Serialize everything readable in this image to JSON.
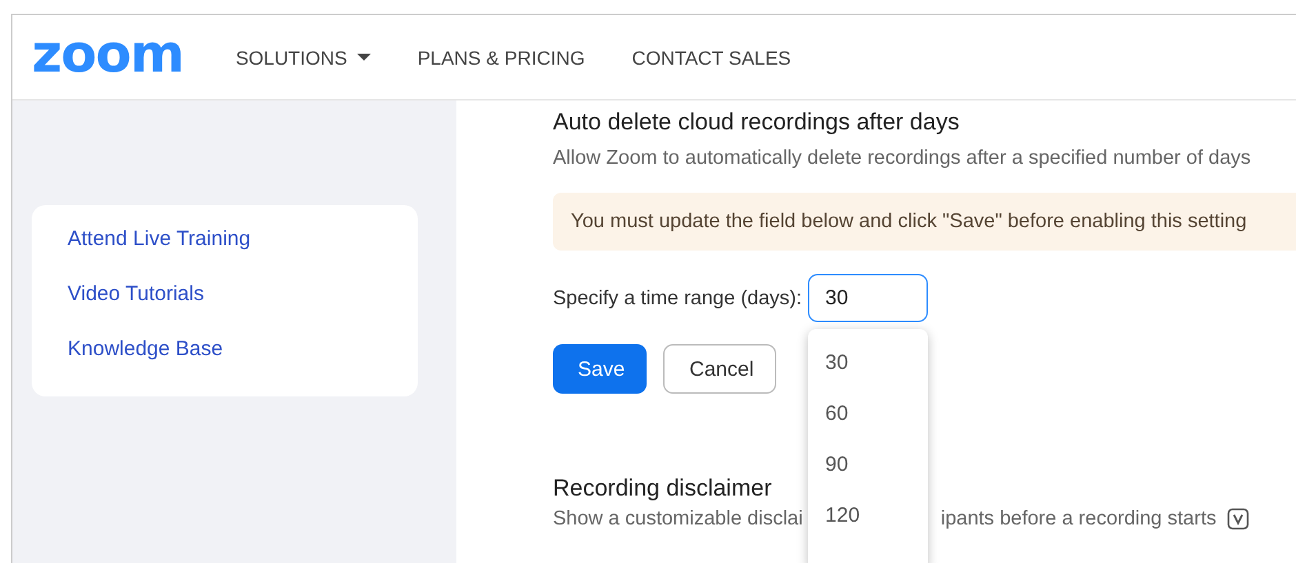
{
  "header": {
    "logo": "zoom",
    "nav": [
      {
        "label": "SOLUTIONS",
        "dropdown": true
      },
      {
        "label": "PLANS & PRICING",
        "dropdown": false
      },
      {
        "label": "CONTACT SALES",
        "dropdown": false
      }
    ]
  },
  "sidebar": {
    "links": [
      "Attend Live Training",
      "Video Tutorials",
      "Knowledge Base"
    ]
  },
  "setting": {
    "title": "Auto delete cloud recordings after days",
    "description": "Allow Zoom to automatically delete recordings after a specified number of days",
    "notice": "You must update the field below and click \"Save\" before enabling this setting",
    "field_label": "Specify a time range (days):",
    "field_value": "30",
    "options": [
      "30",
      "60",
      "90",
      "120"
    ],
    "buttons": [
      {
        "label": "Save",
        "kind": "primary"
      },
      {
        "label": "Cancel",
        "kind": "secondary"
      }
    ]
  },
  "disclaimer": {
    "title": "Recording disclaimer",
    "description_before": "Show a customizable disclai",
    "description_after": "ipants before a recording starts"
  }
}
